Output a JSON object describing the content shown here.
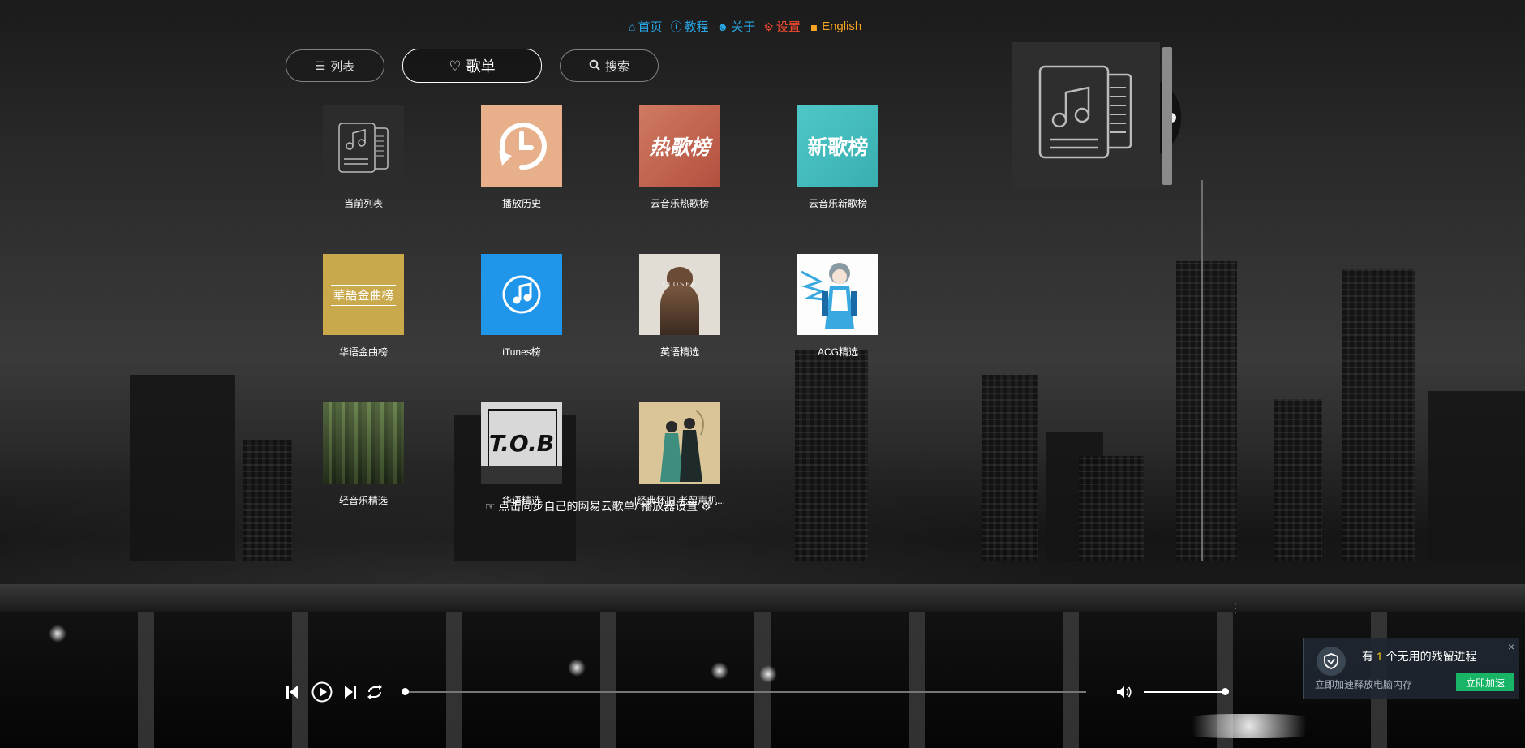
{
  "nav": {
    "home": "首页",
    "tutorial": "教程",
    "about": "关于",
    "settings": "设置",
    "language": "English"
  },
  "tabs": {
    "list": "列表",
    "playlists": "歌单",
    "search": "搜索"
  },
  "playlists": [
    {
      "title": "当前列表",
      "cover": "music-list-icon"
    },
    {
      "title": "播放历史",
      "cover": "history-icon"
    },
    {
      "title": "云音乐热歌榜",
      "cover": "热歌榜"
    },
    {
      "title": "云音乐新歌榜",
      "cover": "新歌榜"
    },
    {
      "title": "华语金曲榜",
      "cover": "華語金曲榜"
    },
    {
      "title": "iTunes榜",
      "cover": "music-note-icon"
    },
    {
      "title": "英语精选",
      "cover": "CLOSER"
    },
    {
      "title": "ACG精选",
      "cover": "anime-character"
    },
    {
      "title": "轻音乐精选",
      "cover": "forest-photo"
    },
    {
      "title": "华语精选",
      "cover": "T.O.B"
    },
    {
      "title": "|经典怀旧|老留声机...",
      "cover": "painting"
    }
  ],
  "sync_text": "点击同步自己的网易云歌单/ 播放器设置",
  "player": {
    "progress": 0,
    "volume": 1.0
  },
  "toast": {
    "prefix": "有",
    "count": "1",
    "suffix": "个无用的残留进程",
    "subtitle": "立即加速释放电脑内存",
    "button": "立即加速",
    "close": "×"
  },
  "colors": {
    "nav_blue": "#28a7e6",
    "nav_red": "#f04a2f",
    "nav_orange": "#f6a623",
    "toast_button": "#18b566"
  }
}
